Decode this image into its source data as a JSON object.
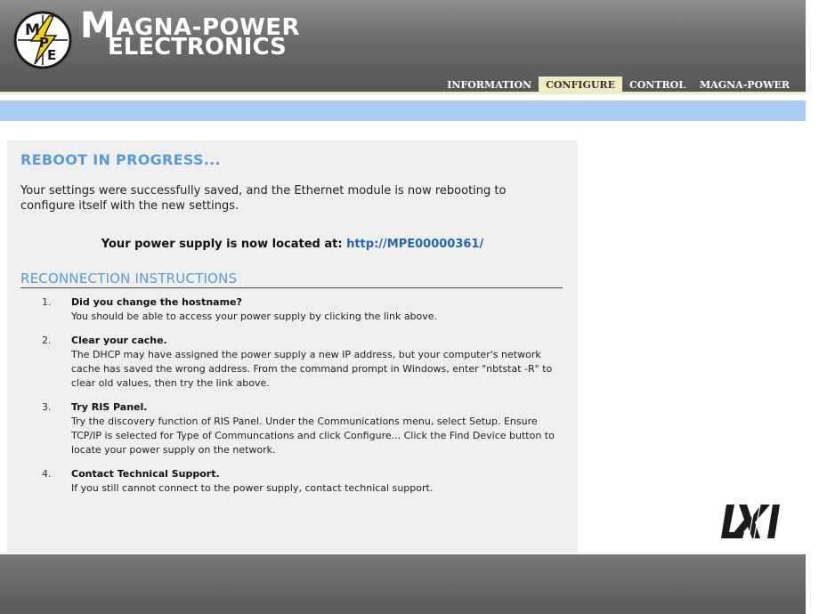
{
  "brand": {
    "logo_letters": [
      "M",
      "P",
      "E"
    ],
    "line1_initial": "M",
    "line1_rest": "AGNA-POWER",
    "line2": "ELECTRONICS"
  },
  "nav": {
    "items": [
      {
        "label": "INFORMATION",
        "active": false
      },
      {
        "label": "CONFIGURE",
        "active": true
      },
      {
        "label": "CONTROL",
        "active": false
      },
      {
        "label": "MAGNA-POWER",
        "active": false
      }
    ]
  },
  "main": {
    "title": "REBOOT IN PROGRESS...",
    "intro": "Your settings were successfully saved, and the Ethernet module is now rebooting to configure itself with the new settings.",
    "location_label": "Your power supply is now located at:",
    "location_link": "http://MPE00000361/",
    "reconnect_heading": "RECONNECTION INSTRUCTIONS",
    "steps": [
      {
        "num": "1.",
        "title": "Did you change the hostname?",
        "body": "You should be able to access your power supply by clicking the link above."
      },
      {
        "num": "2.",
        "title": "Clear your cache.",
        "body": "The DHCP may have assigned the power supply a new IP address, but your computer's network cache has saved the wrong address. From the command prompt in Windows, enter \"nbtstat -R\" to clear old values, then try the link above."
      },
      {
        "num": "3.",
        "title": "Try RIS Panel.",
        "body": "Try the discovery function of RIS Panel. Under the Communications menu, select Setup. Ensure TCP/IP is selected for Type of Communcations and click Configure... Click the Find Device button to locate your power supply on the network."
      },
      {
        "num": "4.",
        "title": "Contact Technical Support.",
        "body": "If you still cannot connect to the power supply, contact technical support."
      }
    ]
  },
  "lxi_logo": "LXI",
  "colors": {
    "accent_blue": "#5b9bd5",
    "link_blue": "#2a64b0",
    "nav_active_bg": "#f2ecc4",
    "subbar": "#a9cdf2",
    "logo_bolt": "#f2d21b"
  }
}
